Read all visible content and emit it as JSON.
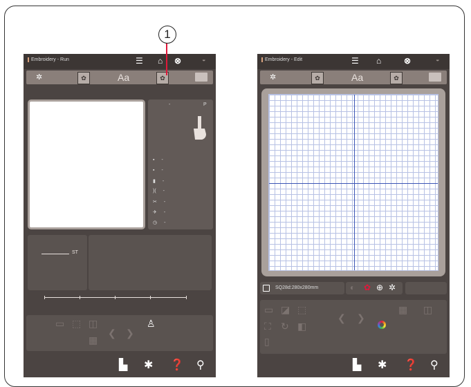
{
  "callout": {
    "number": "1"
  },
  "left_screen": {
    "title": "Embroidery - Run",
    "status_icons": [
      "menu-icon",
      "home-icon",
      "jk-logo-icon",
      "wifi-icon"
    ],
    "toolbar": {
      "items": [
        {
          "name": "design-icon",
          "glyph": "✲"
        },
        {
          "name": "built-in-pattern-icon",
          "glyph": "✿"
        },
        {
          "name": "font-icon",
          "glyph": "Aa"
        },
        {
          "name": "edit-pattern-icon",
          "glyph": "✿"
        },
        {
          "name": "collapse-icon",
          "glyph": ""
        }
      ]
    },
    "info_panel": {
      "header_left": "-",
      "header_right": "P",
      "rows": [
        {
          "icon": "▪",
          "value": "-"
        },
        {
          "icon": "▪",
          "value": "-"
        },
        {
          "icon": "▮",
          "value": "-"
        },
        {
          "icon": ")(",
          "value": "-"
        },
        {
          "icon": "✂",
          "value": "-"
        },
        {
          "icon": "✈",
          "value": "-"
        },
        {
          "icon": "◷",
          "value": "-"
        }
      ]
    },
    "thread_label": "ST",
    "nav_icons": [
      "machine-icon",
      "settings-icon",
      "help-icon",
      "wrench-icon"
    ]
  },
  "right_screen": {
    "title": "Embroidery - Edit",
    "hoop_label": "SQ28d:280x280mm",
    "nav_icons": [
      "machine-icon",
      "settings-icon",
      "help-icon",
      "wrench-icon"
    ]
  }
}
